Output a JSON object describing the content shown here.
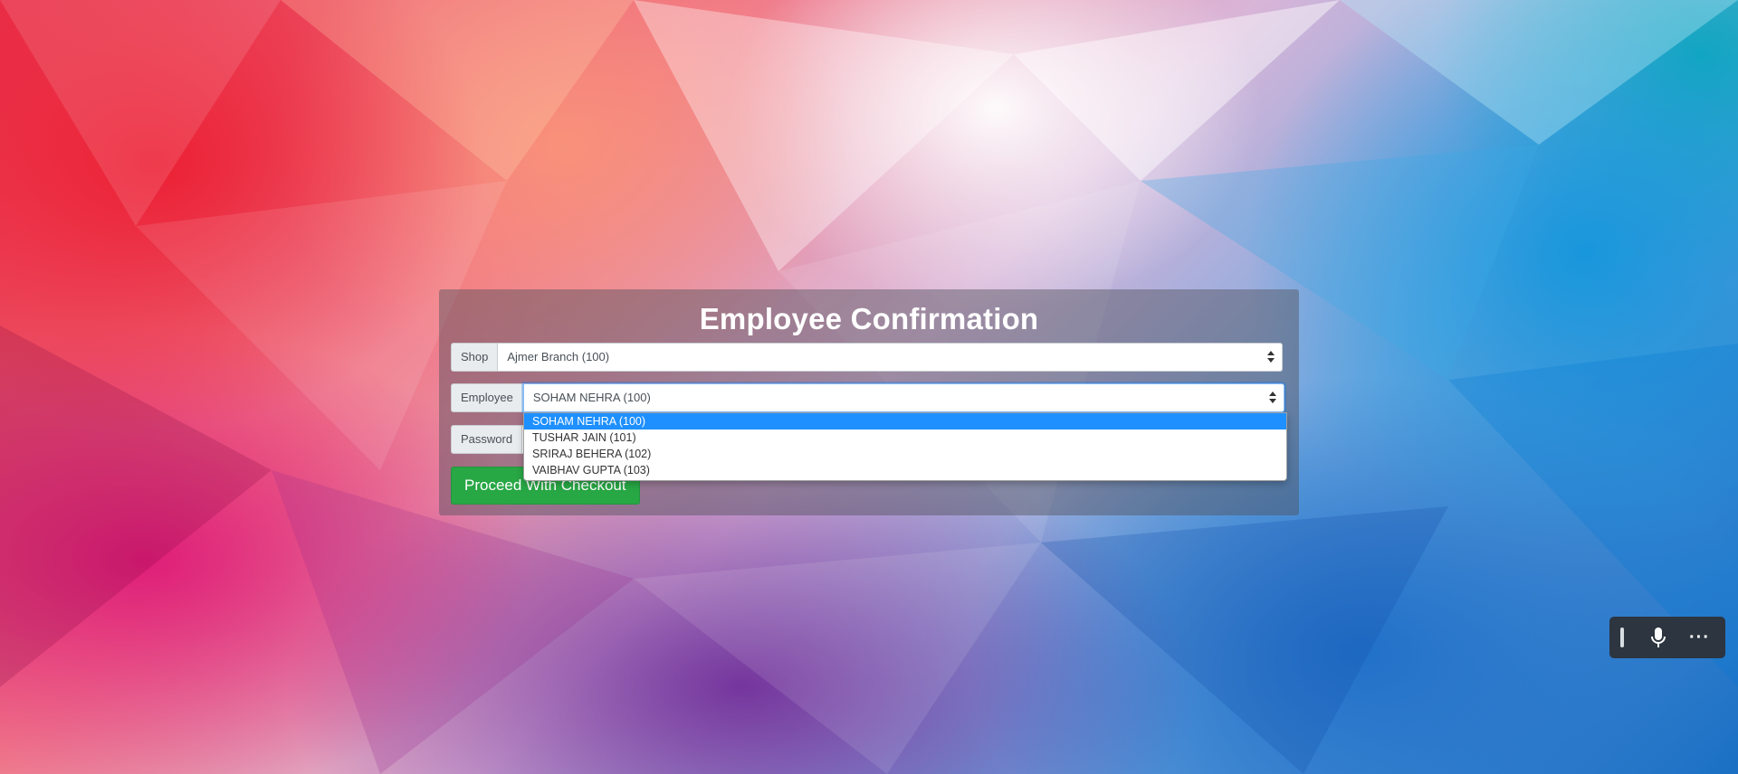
{
  "form": {
    "title": "Employee Confirmation",
    "shop_label": "Shop",
    "shop_value": "Ajmer Branch (100)",
    "employee_label": "Employee",
    "employee_value": "SOHAM NEHRA (100)",
    "password_label": "Password",
    "password_value": "",
    "proceed_label": "Proceed With Checkout"
  },
  "employee_options": [
    "SOHAM NEHRA (100)",
    "TUSHAR JAIN (101)",
    "SRIRAJ BEHERA (102)",
    "VAIBHAV GUPTA (103)"
  ],
  "voice_toolbar": {
    "icons": [
      "drag-handle-icon",
      "microphone-icon",
      "more-options-icon"
    ],
    "more_glyph": "···"
  },
  "colors": {
    "proceed_button": "#28a745",
    "selected_option": "#1e90ff"
  }
}
